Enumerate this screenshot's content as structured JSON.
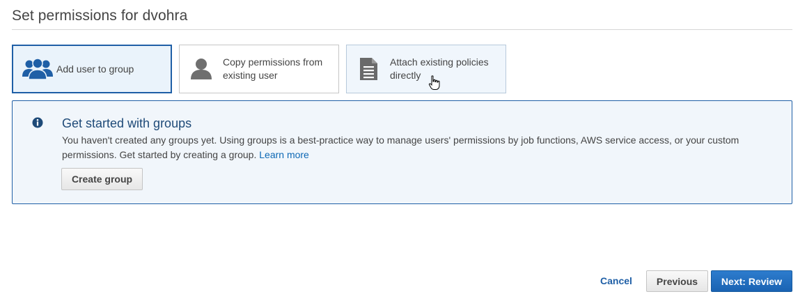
{
  "page": {
    "title": "Set permissions for dvohra"
  },
  "options": [
    {
      "label": "Add user to group",
      "icon": "user-group-icon",
      "selected": true
    },
    {
      "label": "Copy permissions from\nexisting user",
      "icon": "user-icon",
      "selected": false
    },
    {
      "label": "Attach existing policies\ndirectly",
      "icon": "document-icon",
      "selected": false
    }
  ],
  "info": {
    "icon": "info-icon",
    "title": "Get started with groups",
    "text": "You haven't created any groups yet. Using groups is a best-practice way to manage users' permissions by job functions, AWS service access, or your custom permissions. Get started by creating a group.",
    "learn_more": "Learn more",
    "create_button": "Create group"
  },
  "footer": {
    "cancel": "Cancel",
    "previous": "Previous",
    "next": "Next: Review"
  },
  "colors": {
    "accent": "#1f5fa6",
    "primary_button": "#1a63b3",
    "info_background": "#f1f6fb",
    "link": "#0d68b5"
  }
}
